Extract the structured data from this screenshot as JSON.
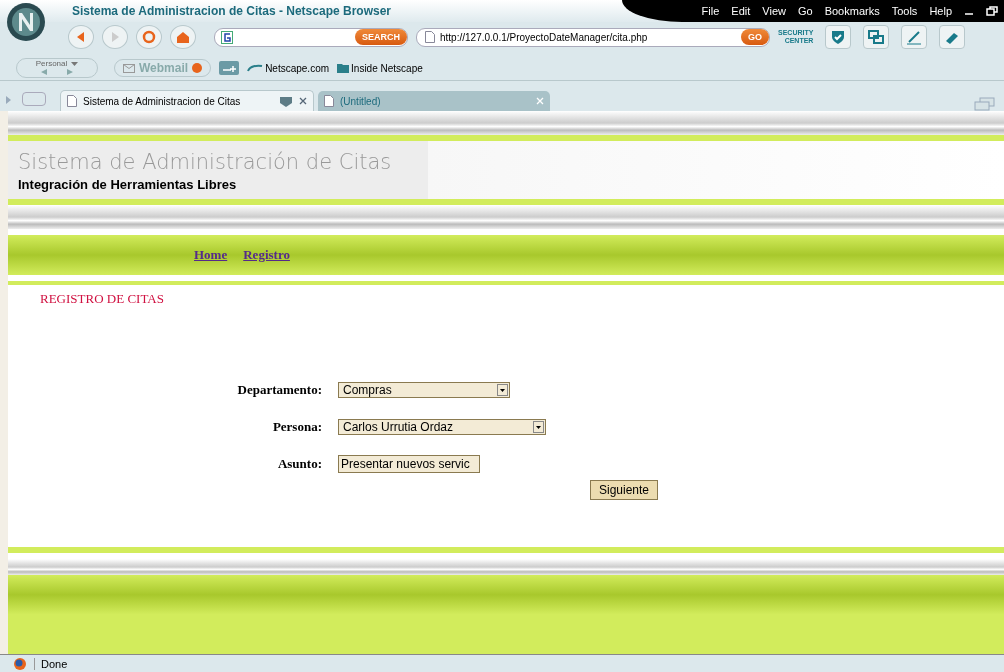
{
  "window": {
    "title": "Sistema de Administracion de Citas - Netscape Browser"
  },
  "menu": [
    "File",
    "Edit",
    "View",
    "Go",
    "Bookmarks",
    "Tools",
    "Help"
  ],
  "toolbar": {
    "search_button": "SEARCH",
    "url": "http://127.0.0.1/ProyectoDateManager/cita.php",
    "go_button": "GO",
    "security_center": [
      "SECURITY",
      "CENTER"
    ]
  },
  "personal_bar": {
    "personal": "Personal",
    "webmail": "Webmail",
    "bookmarks": [
      "Netscape.com",
      "Inside Netscape"
    ]
  },
  "tabs": [
    {
      "label": "Sistema de Administracion de Citas",
      "selected": true
    },
    {
      "label": "(Untitled)",
      "selected": false
    }
  ],
  "page": {
    "site_title": "Sistema de Administración de Citas",
    "subtitle": "Integración de Herramientas Libres",
    "nav_links": [
      "Home",
      "Registro"
    ],
    "heading": "REGISTRO DE CITAS",
    "fields": [
      {
        "label": "Departamento:",
        "kind": "select",
        "value": "Compras"
      },
      {
        "label": "Persona:",
        "kind": "select",
        "value": "Carlos Urrutia Ordaz"
      },
      {
        "label": "Asunto:",
        "kind": "text",
        "value": "Presentar nuevos servic"
      }
    ],
    "submit": "Siguiente"
  },
  "status_bar": {
    "text": "Done"
  }
}
